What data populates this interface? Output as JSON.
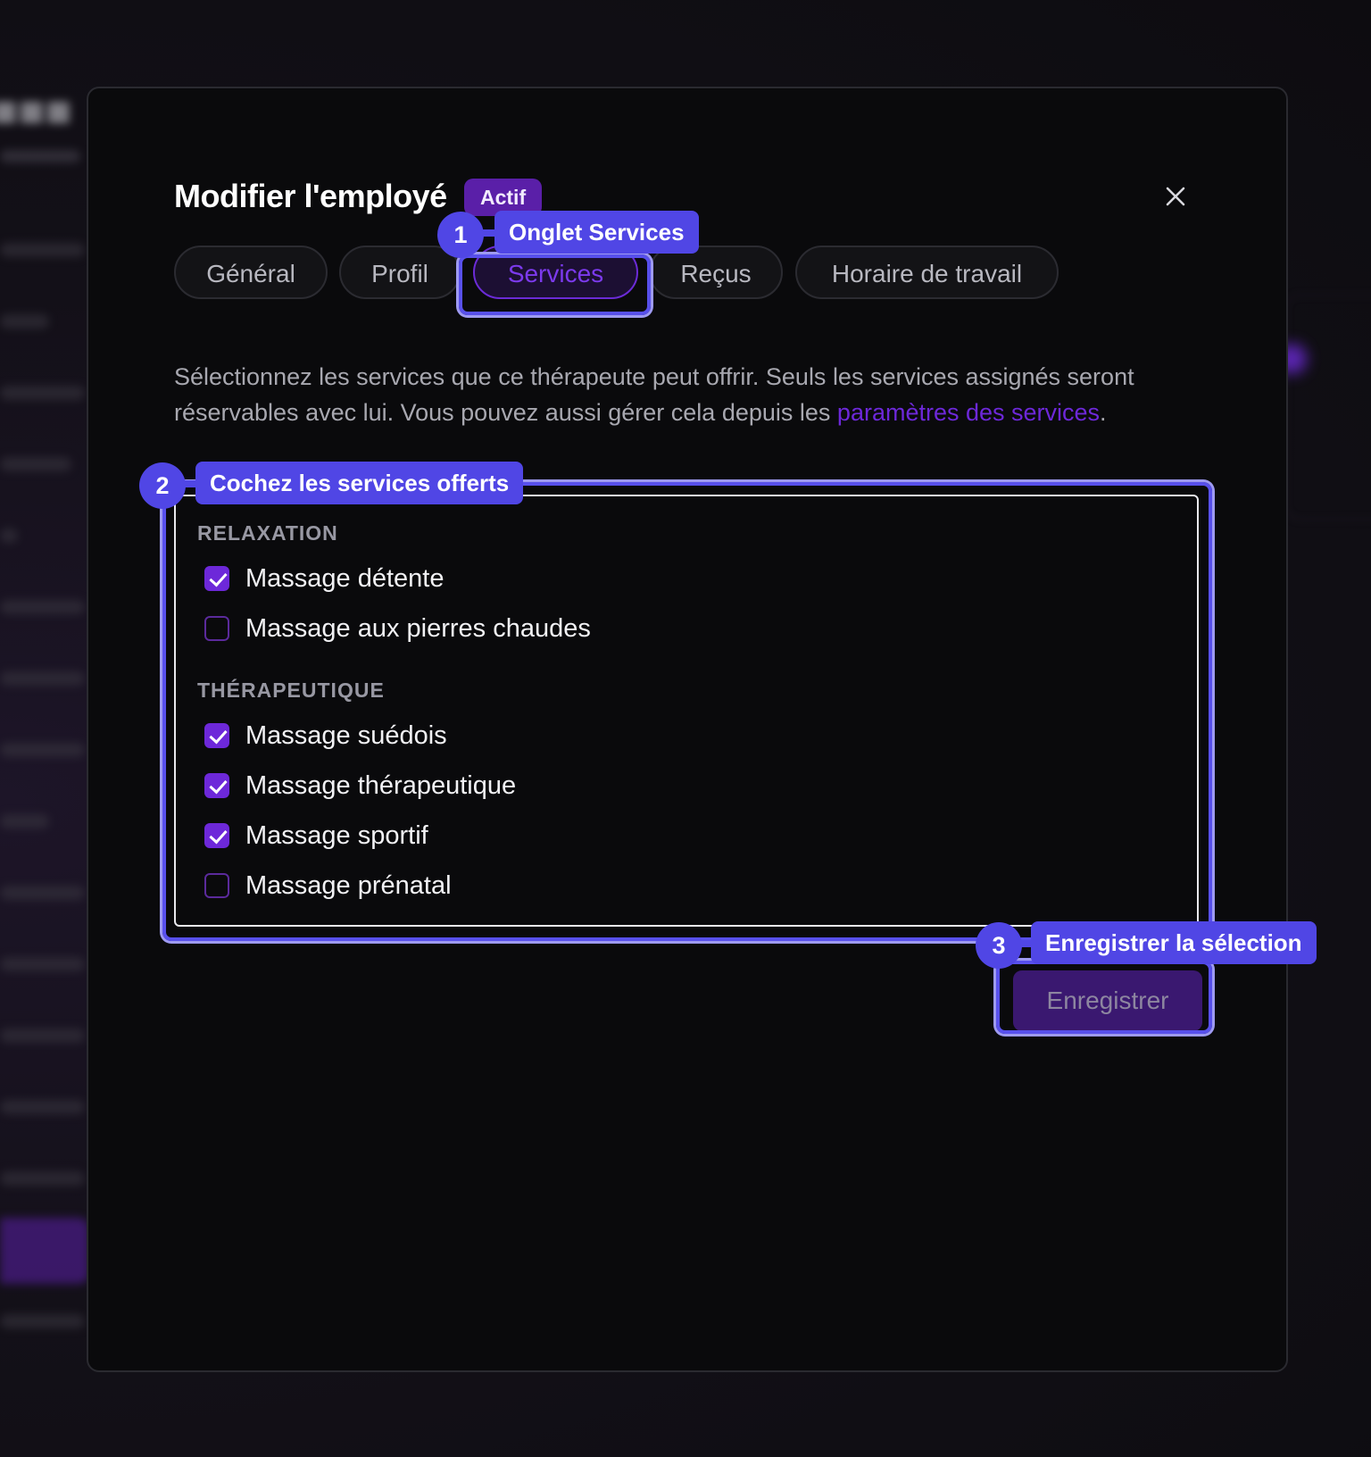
{
  "modal": {
    "title": "Modifier l'employé",
    "status_badge": "Actif",
    "close_icon": "close-icon",
    "tabs": [
      {
        "label": "Général",
        "active": false
      },
      {
        "label": "Profil",
        "active": false
      },
      {
        "label": "Services",
        "active": true
      },
      {
        "label": "Reçus",
        "active": false
      },
      {
        "label": "Horaire de travail",
        "active": false
      }
    ],
    "description": {
      "text": "Sélectionnez les services que ce thérapeute peut offrir. Seuls les services assignés seront réservables avec lui. Vous pouvez aussi gérer cela depuis les ",
      "link": "paramètres des services",
      "trailing": "."
    },
    "categories": [
      {
        "name": "RELAXATION",
        "services": [
          {
            "label": "Massage détente",
            "checked": true
          },
          {
            "label": "Massage aux pierres chaudes",
            "checked": false
          }
        ]
      },
      {
        "name": "THÉRAPEUTIQUE",
        "services": [
          {
            "label": "Massage suédois",
            "checked": true
          },
          {
            "label": "Massage thérapeutique",
            "checked": true
          },
          {
            "label": "Massage sportif",
            "checked": true
          },
          {
            "label": "Massage prénatal",
            "checked": false
          }
        ]
      }
    ],
    "save_label": "Enregistrer"
  },
  "annotations": [
    {
      "number": "1",
      "label": "Onglet Services"
    },
    {
      "number": "2",
      "label": "Cochez les services offerts"
    },
    {
      "number": "3",
      "label": "Enregistrer la sélection"
    }
  ],
  "colors": {
    "accent": "#6d28d9",
    "annotation": "#5046e5",
    "modal_bg": "#0a0a0c"
  }
}
